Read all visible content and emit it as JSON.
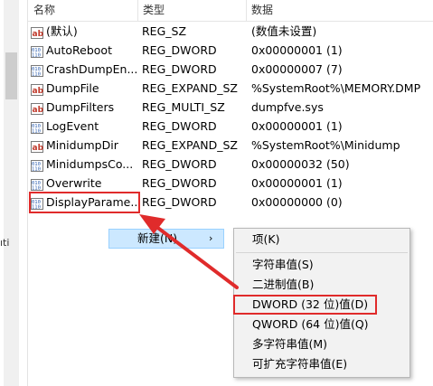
{
  "left_fragment": "ıti",
  "columns": {
    "name": "名称",
    "type": "类型",
    "data": "数据"
  },
  "entries": [
    {
      "icon": "string-value-icon",
      "name": "(默认)",
      "type": "REG_SZ",
      "data": "(数值未设置)"
    },
    {
      "icon": "binary-value-icon",
      "name": "AutoReboot",
      "type": "REG_DWORD",
      "data": "0x00000001 (1)"
    },
    {
      "icon": "binary-value-icon",
      "name": "CrashDumpEn...",
      "type": "REG_DWORD",
      "data": "0x00000007 (7)"
    },
    {
      "icon": "string-value-icon",
      "name": "DumpFile",
      "type": "REG_EXPAND_SZ",
      "data": "%SystemRoot%\\MEMORY.DMP"
    },
    {
      "icon": "string-value-icon",
      "name": "DumpFilters",
      "type": "REG_MULTI_SZ",
      "data": "dumpfve.sys"
    },
    {
      "icon": "binary-value-icon",
      "name": "LogEvent",
      "type": "REG_DWORD",
      "data": "0x00000001 (1)"
    },
    {
      "icon": "string-value-icon",
      "name": "MinidumpDir",
      "type": "REG_EXPAND_SZ",
      "data": "%SystemRoot%\\Minidump"
    },
    {
      "icon": "binary-value-icon",
      "name": "MinidumpsCo...",
      "type": "REG_DWORD",
      "data": "0x00000032 (50)"
    },
    {
      "icon": "binary-value-icon",
      "name": "Overwrite",
      "type": "REG_DWORD",
      "data": "0x00000001 (1)"
    },
    {
      "icon": "binary-value-icon",
      "name": "DisplayParame...",
      "type": "REG_DWORD",
      "data": "0x00000000 (0)"
    }
  ],
  "context_menu": {
    "new_label": "新建(N)",
    "new_arrow": "›",
    "items": {
      "key": "项(K)",
      "string": "字符串值(S)",
      "binary": "二进制值(B)",
      "dword": "DWORD (32 位)值(D)",
      "qword": "QWORD (64 位)值(Q)",
      "multi_string": "多字符串值(M)",
      "expandable_string": "可扩充字符串值(E)"
    }
  },
  "colors": {
    "annotation_red": "#e02b2b",
    "string_icon": "#c0392b",
    "binary_icon": "#2a5db0",
    "menu_highlight": "#cce8ff"
  }
}
